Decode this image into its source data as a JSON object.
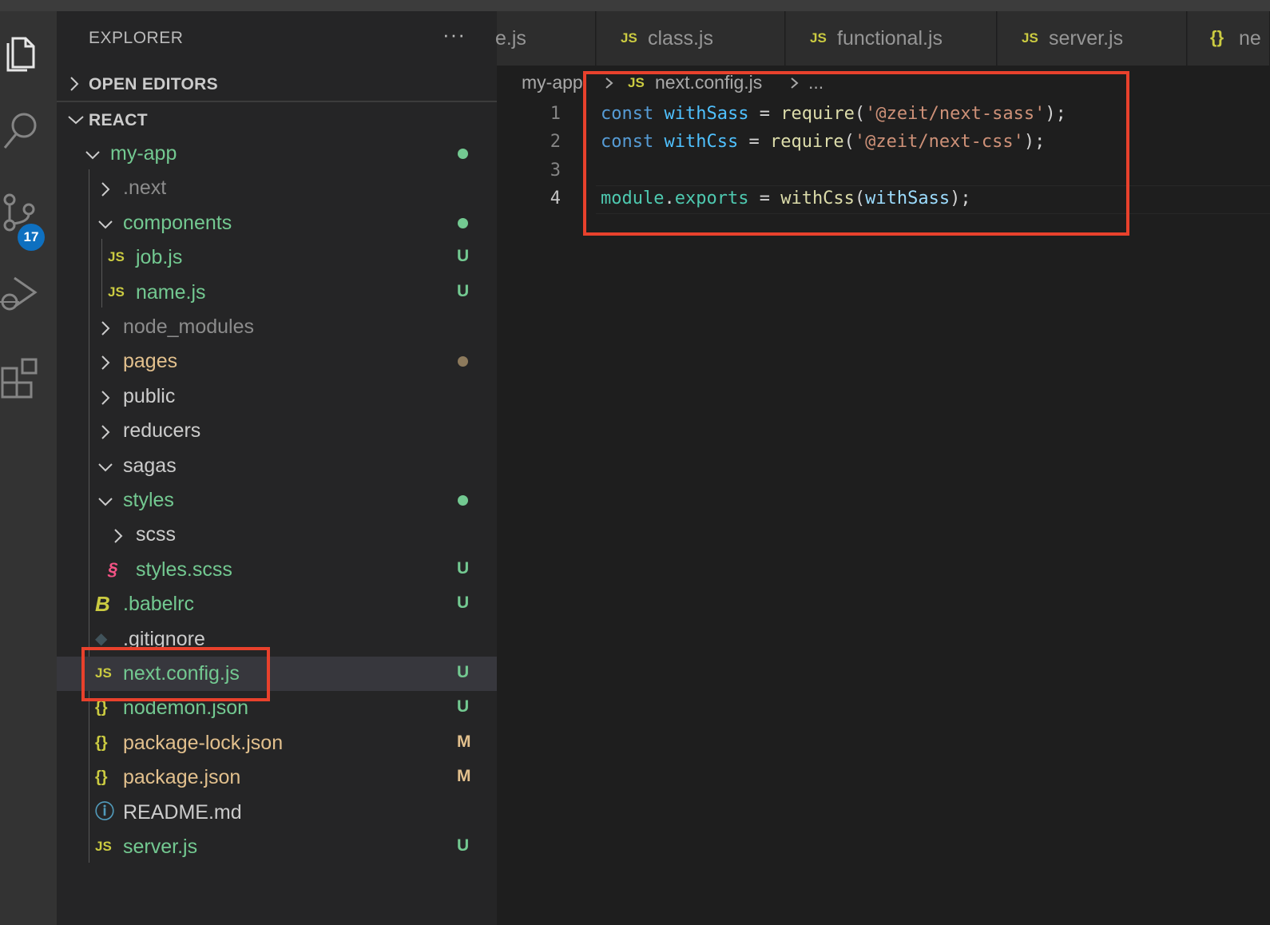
{
  "explorer": {
    "title": "EXPLORER",
    "more": "···",
    "open_editors": "OPEN EDITORS",
    "workspace": "REACT"
  },
  "activity": {
    "scm_badge": "17"
  },
  "tree": [
    {
      "name": "my-app",
      "kind": "folder-open",
      "color": "#73c991",
      "status": "dot",
      "status_color": "#73c991"
    },
    {
      "name": ".next",
      "kind": "folder",
      "color": "#8c8c8c",
      "status": "",
      "status_color": ""
    },
    {
      "name": "components",
      "kind": "folder-open",
      "color": "#73c991",
      "status": "dot",
      "status_color": "#73c991"
    },
    {
      "name": "job.js",
      "kind": "js",
      "color": "#73c991",
      "status": "U",
      "status_color": "#73c991"
    },
    {
      "name": "name.js",
      "kind": "js",
      "color": "#73c991",
      "status": "U",
      "status_color": "#73c991"
    },
    {
      "name": "node_modules",
      "kind": "folder",
      "color": "#8c8c8c",
      "status": "",
      "status_color": ""
    },
    {
      "name": "pages",
      "kind": "folder",
      "color": "#e2c08d",
      "status": "dot",
      "status_color": "#8d7a5c"
    },
    {
      "name": "public",
      "kind": "folder",
      "color": "#cccccc",
      "status": "",
      "status_color": ""
    },
    {
      "name": "reducers",
      "kind": "folder",
      "color": "#cccccc",
      "status": "",
      "status_color": ""
    },
    {
      "name": "sagas",
      "kind": "folder-open",
      "color": "#cccccc",
      "status": "",
      "status_color": ""
    },
    {
      "name": "styles",
      "kind": "folder-open",
      "color": "#73c991",
      "status": "dot",
      "status_color": "#73c991"
    },
    {
      "name": "scss",
      "kind": "folder",
      "color": "#cccccc",
      "status": "",
      "status_color": ""
    },
    {
      "name": "styles.scss",
      "kind": "scss",
      "color": "#73c991",
      "status": "U",
      "status_color": "#73c991"
    },
    {
      "name": ".babelrc",
      "kind": "babel",
      "color": "#73c991",
      "status": "U",
      "status_color": "#73c991"
    },
    {
      "name": ".gitignore",
      "kind": "git",
      "color": "#cccccc",
      "status": "",
      "status_color": ""
    },
    {
      "name": "next.config.js",
      "kind": "js",
      "color": "#73c991",
      "status": "U",
      "status_color": "#73c991"
    },
    {
      "name": "nodemon.json",
      "kind": "json",
      "color": "#73c991",
      "status": "U",
      "status_color": "#73c991"
    },
    {
      "name": "package-lock.json",
      "kind": "json",
      "color": "#e2c08d",
      "status": "M",
      "status_color": "#e2c08d"
    },
    {
      "name": "package.json",
      "kind": "json",
      "color": "#e2c08d",
      "status": "M",
      "status_color": "#e2c08d"
    },
    {
      "name": "README.md",
      "kind": "info",
      "color": "#cccccc",
      "status": "",
      "status_color": ""
    },
    {
      "name": "server.js",
      "kind": "js",
      "color": "#73c991",
      "status": "U",
      "status_color": "#73c991"
    }
  ],
  "tabs": [
    {
      "label": "e.js",
      "icon": ""
    },
    {
      "label": "class.js",
      "icon": "JS"
    },
    {
      "label": "functional.js",
      "icon": "JS"
    },
    {
      "label": "server.js",
      "icon": "JS"
    },
    {
      "label": "ne",
      "icon": "{}"
    }
  ],
  "breadcrumb": {
    "folder": "my-app",
    "file": "next.config.js",
    "more": "..."
  },
  "code": {
    "line_numbers": [
      "1",
      "2",
      "3",
      "4"
    ],
    "line1": {
      "kw": "const",
      "var": "withSass",
      "eq": " = ",
      "fn": "require",
      "open": "(",
      "str": "'@zeit/next-sass'",
      "close": ");"
    },
    "line2": {
      "kw": "const",
      "var": "withCss",
      "eq": " = ",
      "fn": "require",
      "open": "(",
      "str": "'@zeit/next-css'",
      "close": ");"
    },
    "line4": {
      "mod": "module",
      "dot": ".",
      "prop": "exports",
      "eq": " = ",
      "fn": "withCss",
      "open": "(",
      "arg": "withSass",
      "close": ");"
    }
  },
  "colors": {
    "accent_badge": "#0e70c0",
    "highlight_box": "#e8412c",
    "untracked": "#73c991",
    "modified": "#e2c08d"
  }
}
